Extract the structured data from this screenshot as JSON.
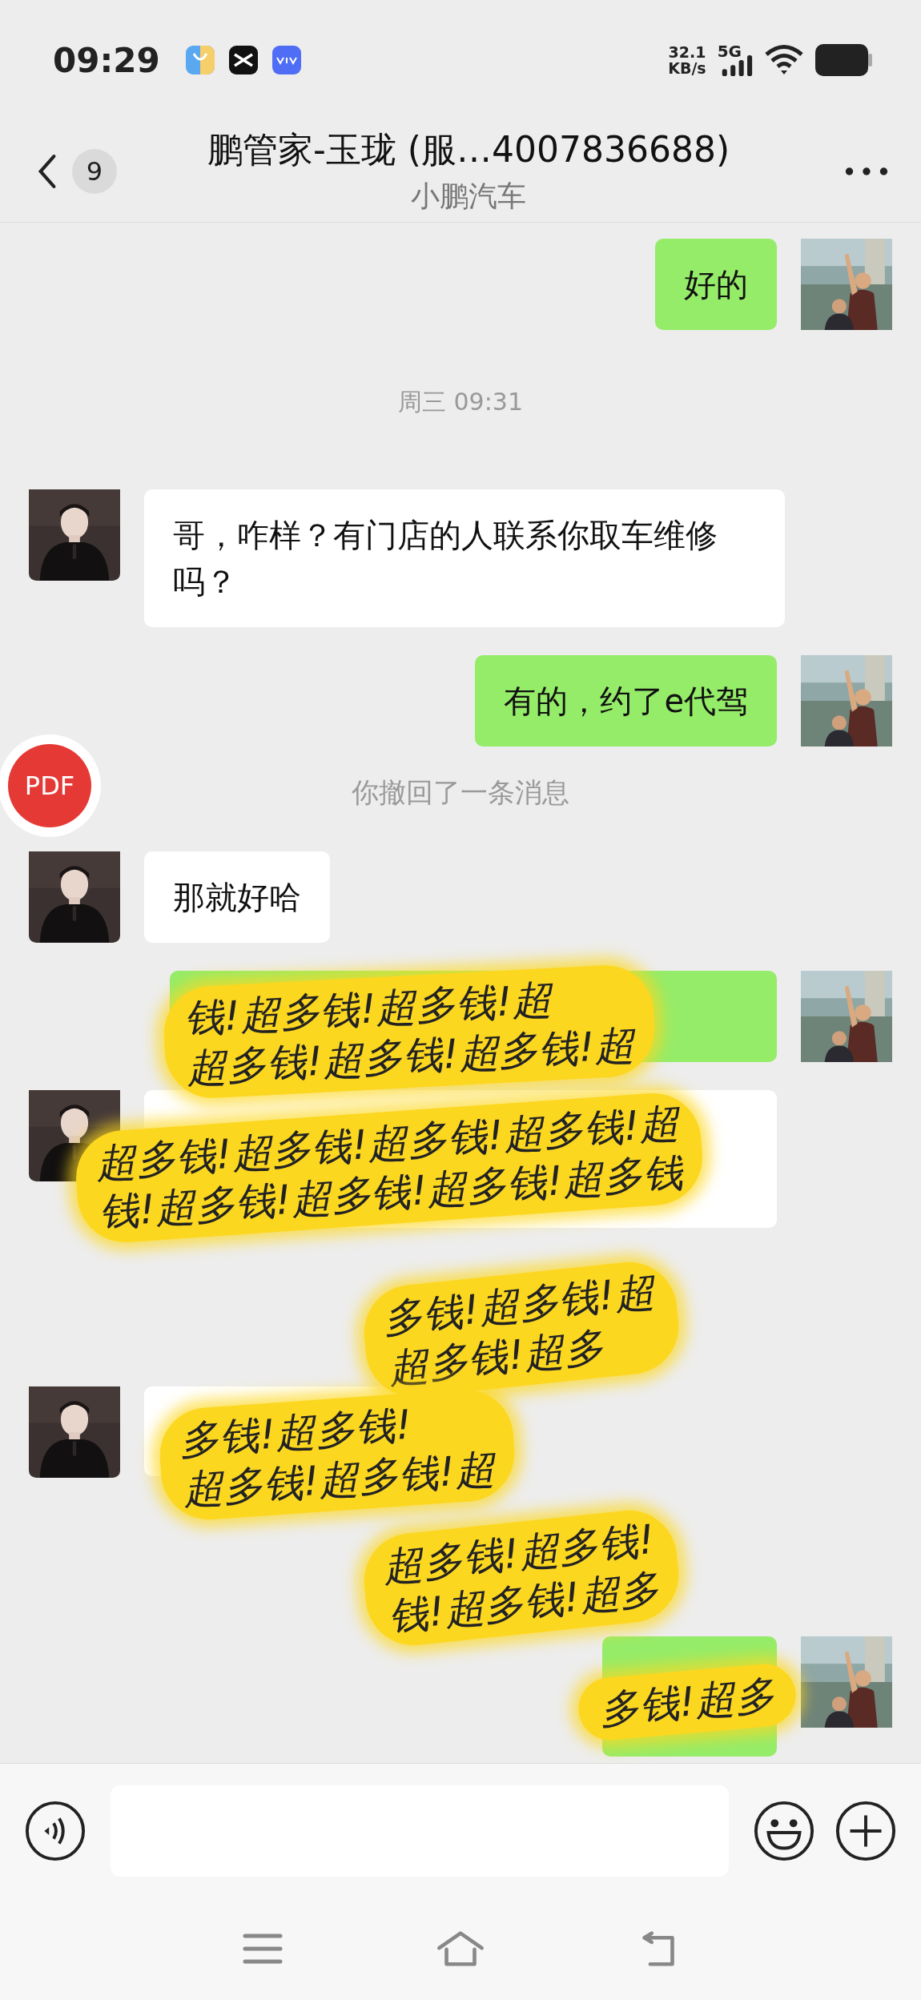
{
  "status_bar": {
    "time": "09:29",
    "speed": "32.1",
    "speed_unit": "KB/s",
    "network": "5G"
  },
  "header": {
    "back_count": "9",
    "title": "鹏管家-玉珑 (服…4007836688)",
    "subtitle": "小鹏汽车"
  },
  "messages": [
    {
      "kind": "out",
      "text": "好的"
    },
    {
      "kind": "time",
      "text": "周三 09:31"
    },
    {
      "kind": "in",
      "text": "哥，咋样？有门店的人联系你取车维修吗？"
    },
    {
      "kind": "out",
      "text": "有的，约了e代驾"
    },
    {
      "kind": "recall",
      "text": "你撤回了一条消息"
    },
    {
      "kind": "in",
      "text": "那就好哈"
    },
    {
      "kind": "out"
    },
    {
      "kind": "in"
    },
    {
      "kind": "in"
    },
    {
      "kind": "out"
    }
  ],
  "stickers": [
    {
      "lines": [
        "钱!超多钱!超多钱!超",
        "超多钱!超多钱!超多钱!超"
      ]
    },
    {
      "lines": [
        "超多钱!超多钱!超多钱!超多钱!超",
        "钱!超多钱!超多钱!超多钱!超多钱"
      ]
    },
    {
      "lines": [
        "多钱!超多钱!超",
        "超多钱!超多"
      ]
    },
    {
      "lines": [
        "多钱!超多钱!",
        "超多钱!超多钱!超"
      ]
    },
    {
      "lines": [
        "超多钱!超多钱!",
        "钱!超多钱!超多"
      ]
    },
    {
      "lines": [
        "多钱!超多"
      ]
    }
  ],
  "floating_button": {
    "label": "PDF"
  }
}
